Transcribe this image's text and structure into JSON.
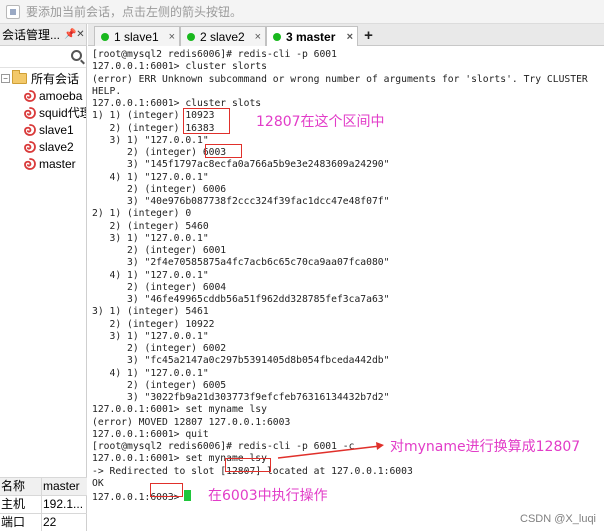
{
  "hint_bar": {
    "text": "要添加当前会话，点击左侧的箭头按钮。"
  },
  "left_panel": {
    "title": "会话管理...",
    "pin": "📌",
    "close": "✕",
    "tree": {
      "root": {
        "label": "所有会话",
        "collapse": "−"
      },
      "items": [
        {
          "label": "amoeba"
        },
        {
          "label": "squid代理"
        },
        {
          "label": "slave1"
        },
        {
          "label": "slave2"
        },
        {
          "label": "master"
        }
      ]
    },
    "properties": {
      "header": {
        "name": "名称",
        "value": "master"
      },
      "rows": [
        {
          "name": "主机",
          "value": "192.1..."
        },
        {
          "name": "端口",
          "value": "22"
        }
      ]
    }
  },
  "tabs": [
    {
      "label": "1 slave1",
      "status_color": "#19b81e"
    },
    {
      "label": "2 slave2",
      "status_color": "#19b81e"
    },
    {
      "label": "3 master",
      "status_color": "#19b81e",
      "active": true
    }
  ],
  "tab_close": "×",
  "tab_add": "+",
  "terminal": {
    "lines": [
      "[root@mysql2 redis6006]# redis-cli -p 6001",
      "127.0.0.1:6001> cluster slorts",
      "(error) ERR Unknown subcommand or wrong number of arguments for 'slorts'. Try CLUSTER",
      "HELP.",
      "127.0.0.1:6001> cluster slots",
      "1) 1) (integer) 10923",
      "   2) (integer) 16383",
      "   3) 1) \"127.0.0.1\"",
      "      2) (integer) 6003",
      "      3) \"145f1797ac8ecfa0a766a5b9e3e2483609a24290\"",
      "   4) 1) \"127.0.0.1\"",
      "      2) (integer) 6006",
      "      3) \"40e976b087738f2ccc324f39fac1dcc47e48f07f\"",
      "2) 1) (integer) 0",
      "   2) (integer) 5460",
      "   3) 1) \"127.0.0.1\"",
      "      2) (integer) 6001",
      "      3) \"2f4e70585875a4fc7acb6c65c70ca9aa07fca080\"",
      "   4) 1) \"127.0.0.1\"",
      "      2) (integer) 6004",
      "      3) \"46fe49965cddb56a51f962dd328785fef3ca7a63\"",
      "3) 1) (integer) 5461",
      "   2) (integer) 10922",
      "   3) 1) \"127.0.0.1\"",
      "      2) (integer) 6002",
      "      3) \"fc45a2147a0c297b5391405d8b054fbceda442db\"",
      "   4) 1) \"127.0.0.1\"",
      "      2) (integer) 6005",
      "      3) \"3022fb9a21d303773f9efcfeb76316134432b7d2\"",
      "127.0.0.1:6001> set myname lsy",
      "(error) MOVED 12807 127.0.0.1:6003",
      "127.0.0.1:6001> quit",
      "[root@mysql2 redis6006]# redis-cli -p 6001 -c",
      "127.0.0.1:6001> set myname lsy",
      "-> Redirected to slot [12807] located at 127.0.0.1:6003",
      "OK",
      "127.0.0.1:6003>"
    ]
  },
  "annotations": {
    "range": "12807在这个区间中",
    "hash": "对myname进行换算成12807",
    "exec": "在6003中执行操作"
  },
  "colors": {
    "annotation": "#e23cc8",
    "highlight_box": "#e0302b",
    "cursor": "#1fc63b"
  },
  "watermark": "CSDN @X_luqi"
}
